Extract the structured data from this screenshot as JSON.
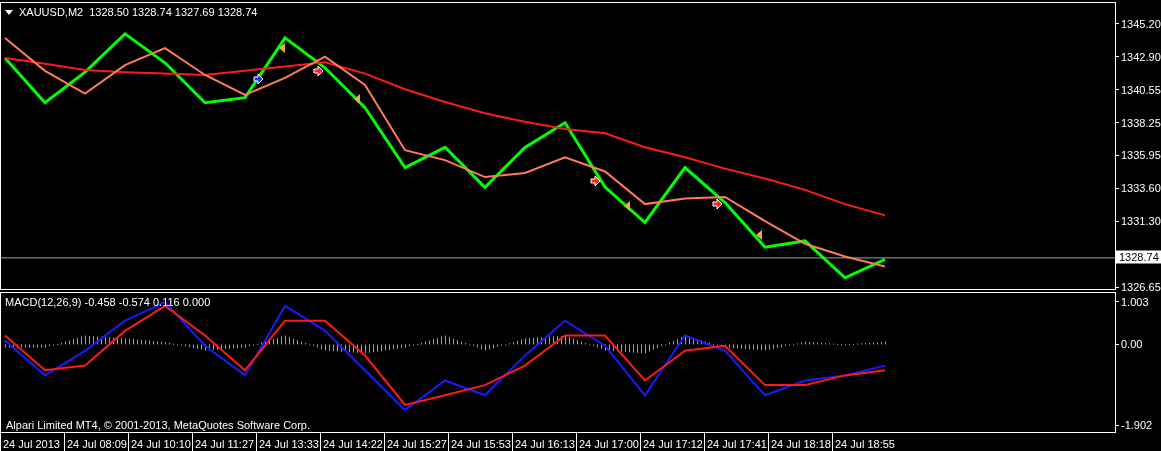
{
  "price_panel": {
    "header": {
      "symbol": "XAUUSD,M2",
      "ohlc": "1328.50 1328.74 1327.69 1328.74"
    },
    "current_price": {
      "label": "1328.74"
    },
    "axis_labels": [
      "1345.20",
      "1342.90",
      "1340.55",
      "1338.25",
      "1335.95",
      "1333.60",
      "1331.30",
      "1326.65"
    ]
  },
  "macd_panel": {
    "label": "MACD(12,26,9) -0.458 -0.574 0.116 0.000",
    "copyright": "Alpari Limited MT4, © 2001-2013, MetaQuotes Software Corp.",
    "axis_labels": [
      "1.003",
      "0.00",
      "-1.902"
    ]
  },
  "time_axis": [
    "24 Jul 2013",
    "24 Jul 08:09",
    "24 Jul 10:10",
    "24 Jul 11:27",
    "24 Jul 13:33",
    "24 Jul 14:22",
    "24 Jul 15:27",
    "24 Jul 15:53",
    "24 Jul 16:13",
    "24 Jul 17:00",
    "24 Jul 17:12",
    "24 Jul 17:41",
    "24 Jul 18:18",
    "24 Jul 18:55"
  ]
}
